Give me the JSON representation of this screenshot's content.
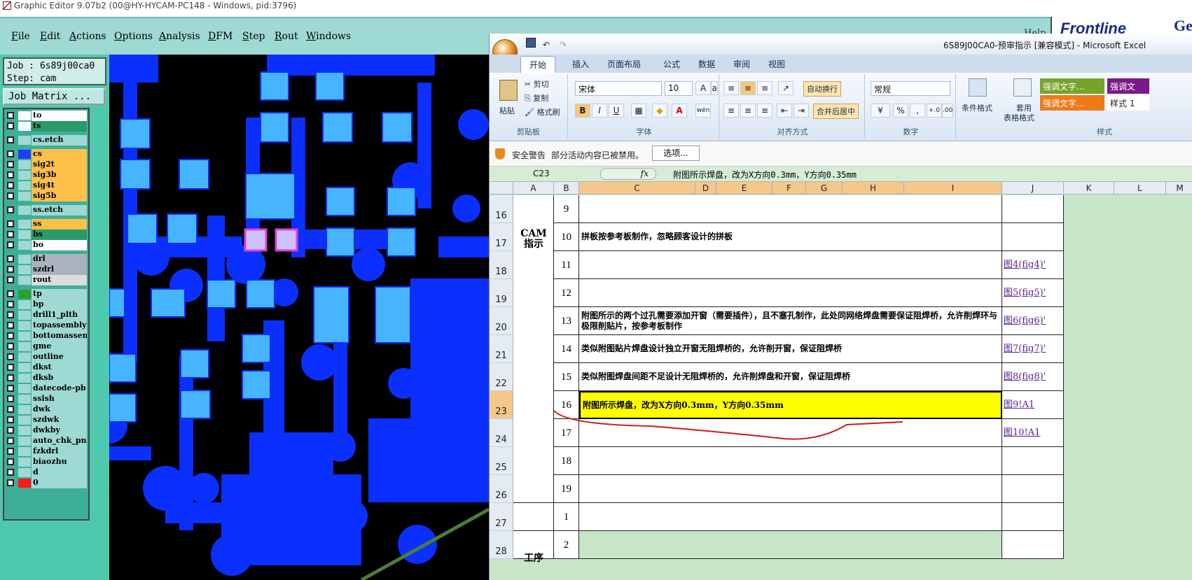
{
  "ge": {
    "title": "Graphic Editor 9.07b2 (00@HY-HYCAM-PC148 - Windows, pid:3796)",
    "menu": [
      "File",
      "Edit",
      "Actions",
      "Options",
      "Analysis",
      "DFM",
      "Step",
      "Rout",
      "Windows"
    ],
    "help": "Help",
    "logo": "Frontline",
    "logo_suffix": "Ge",
    "job": "Job : 6s89j00ca0",
    "step": "Step: cam",
    "job_matrix": "Job Matrix ...",
    "layers": [
      {
        "name": "to",
        "color": "#ffffff",
        "nameBg": "#ffffff"
      },
      {
        "name": "ts",
        "color": "#ffffff",
        "nameBg": "#2a9a6a"
      },
      {
        "name": "cs.etch",
        "color": "#9fd9d3",
        "nameBg": "#9fd9d3"
      },
      {
        "name": "cs",
        "color": "#1e3cff",
        "nameBg": "#ffc04a"
      },
      {
        "name": "sig2t",
        "color": "#9fd9d3",
        "nameBg": "#ffc04a"
      },
      {
        "name": "sig3b",
        "color": "#9fd9d3",
        "nameBg": "#ffc04a"
      },
      {
        "name": "sig4t",
        "color": "#9fd9d3",
        "nameBg": "#ffc04a"
      },
      {
        "name": "sig5b",
        "color": "#9fd9d3",
        "nameBg": "#ffc04a"
      },
      {
        "name": "ss.etch",
        "color": "#9fd9d3",
        "nameBg": "#9fd9d3"
      },
      {
        "name": "ss",
        "color": "#9fd9d3",
        "nameBg": "#ffc04a"
      },
      {
        "name": "bs",
        "color": "#9fd9d3",
        "nameBg": "#2a9a6a"
      },
      {
        "name": "bo",
        "color": "#9fd9d3",
        "nameBg": "#ffffff"
      },
      {
        "name": "drl",
        "color": "#9fd9d3",
        "nameBg": "#a9b3bd"
      },
      {
        "name": "szdrl",
        "color": "#9fd9d3",
        "nameBg": "#a9b3bd"
      },
      {
        "name": "rout",
        "color": "#9fd9d3",
        "nameBg": "#dddddd"
      },
      {
        "name": "tp",
        "color": "#2aa02a",
        "nameBg": "#9fd9d3"
      },
      {
        "name": "bp",
        "color": "#9fd9d3",
        "nameBg": "#9fd9d3"
      },
      {
        "name": "drill1_plth",
        "color": "#9fd9d3",
        "nameBg": "#9fd9d3"
      },
      {
        "name": "topassembly",
        "color": "#9fd9d3",
        "nameBg": "#9fd9d3"
      },
      {
        "name": "bottomassembly",
        "color": "#9fd9d3",
        "nameBg": "#9fd9d3"
      },
      {
        "name": "gme",
        "color": "#9fd9d3",
        "nameBg": "#9fd9d3"
      },
      {
        "name": "outline",
        "color": "#9fd9d3",
        "nameBg": "#9fd9d3"
      },
      {
        "name": "dkst",
        "color": "#9fd9d3",
        "nameBg": "#9fd9d3"
      },
      {
        "name": "dksb",
        "color": "#9fd9d3",
        "nameBg": "#9fd9d3"
      },
      {
        "name": "datecode-pb",
        "color": "#9fd9d3",
        "nameBg": "#9fd9d3"
      },
      {
        "name": "sslsh",
        "color": "#9fd9d3",
        "nameBg": "#9fd9d3"
      },
      {
        "name": "dwk",
        "color": "#9fd9d3",
        "nameBg": "#9fd9d3"
      },
      {
        "name": "szdwk",
        "color": "#9fd9d3",
        "nameBg": "#9fd9d3"
      },
      {
        "name": "dwkby",
        "color": "#9fd9d3",
        "nameBg": "#9fd9d3"
      },
      {
        "name": "auto_chk_pn",
        "color": "#9fd9d3",
        "nameBg": "#9fd9d3"
      },
      {
        "name": "fzkdrl",
        "color": "#9fd9d3",
        "nameBg": "#9fd9d3"
      },
      {
        "name": "biaozhu",
        "color": "#9fd9d3",
        "nameBg": "#9fd9d3"
      },
      {
        "name": "d",
        "color": "#9fd9d3",
        "nameBg": "#9fd9d3"
      },
      {
        "name": "0",
        "color": "#ff1a1a",
        "nameBg": "#9fd9d3"
      }
    ],
    "colors": {
      "board": "#000000",
      "copper": "#0a2fff",
      "pad": "#46b4ff",
      "selected": "#ccc0ff"
    }
  },
  "excel": {
    "title": "6S89J00CA0-预审指示 [兼容模式] - Microsoft Excel",
    "tabs": [
      "开始",
      "插入",
      "页面布局",
      "公式",
      "数据",
      "审阅",
      "视图"
    ],
    "clipboard": {
      "paste": "粘贴",
      "cut": "剪切",
      "copy": "复制",
      "format_painter": "格式刷",
      "label": "剪贴板"
    },
    "font": {
      "name": "宋体",
      "size": "10",
      "label": "字体"
    },
    "align": {
      "wrap": "自动换行",
      "merge": "合并后居中",
      "label": "对齐方式"
    },
    "number": {
      "format": "常规",
      "label": "数字",
      "pct": "%",
      "comma": ","
    },
    "styles": {
      "cond": "条件格式",
      "table": "套用",
      "table2": "表格格式",
      "s1": "强调文字...",
      "s2": "强调文",
      "s3": "强调文字...",
      "s4": "样式 1",
      "label": "样式"
    },
    "security": {
      "label": "安全警告",
      "message": "部分活动内容已被禁用。",
      "button": "选项..."
    },
    "namebox": "C23",
    "fx": "fx",
    "formula": "附图所示焊盘，改为X方向0.3mm，Y方向0.35mm",
    "columns": [
      "A",
      "B",
      "C",
      "D",
      "E",
      "F",
      "G",
      "H",
      "I",
      "J",
      "K",
      "L",
      "M"
    ],
    "group_label": "CAM\n指示",
    "group_label2": "工序",
    "rows": [
      {
        "row": "16",
        "num": "9",
        "text": "",
        "link": ""
      },
      {
        "row": "17",
        "num": "10",
        "text": "拼板按参考板制作，忽略顾客设计的拼板",
        "link": ""
      },
      {
        "row": "18",
        "num": "11",
        "text": "",
        "link": "图4(fig4)'"
      },
      {
        "row": "19",
        "num": "12",
        "text": "",
        "link": "图5(fig5)'"
      },
      {
        "row": "20",
        "num": "13",
        "text": "附图所示的两个过孔需要添加开窗（需要插件），且不塞孔制作，此处同网络焊盘需要保证阻焊桥，允许削焊环与极限削贴片，按参考板制作",
        "link": "图6(fig6)'"
      },
      {
        "row": "21",
        "num": "14",
        "text": "类似附图贴片焊盘设计独立开窗无阻焊桥的，允许削开窗，保证阻焊桥",
        "link": "图7(fig7)'"
      },
      {
        "row": "22",
        "num": "15",
        "text": "类似附图焊盘间距不足设计无阻焊桥的，允许削焊盘和开窗，保证阻焊桥",
        "link": "图8(fig8)'"
      },
      {
        "row": "23",
        "num": "16",
        "text": "附图所示焊盘，改为X方向0.3mm，Y方向0.35mm",
        "link": "图9!A1"
      },
      {
        "row": "24",
        "num": "17",
        "text": "",
        "link": "图10!A1"
      },
      {
        "row": "25",
        "num": "18",
        "text": "",
        "link": ""
      },
      {
        "row": "26",
        "num": "19",
        "text": "",
        "link": ""
      },
      {
        "row": "27",
        "num": "1",
        "text": "",
        "link": ""
      },
      {
        "row": "28",
        "num": "2",
        "text": "",
        "link": ""
      }
    ]
  }
}
